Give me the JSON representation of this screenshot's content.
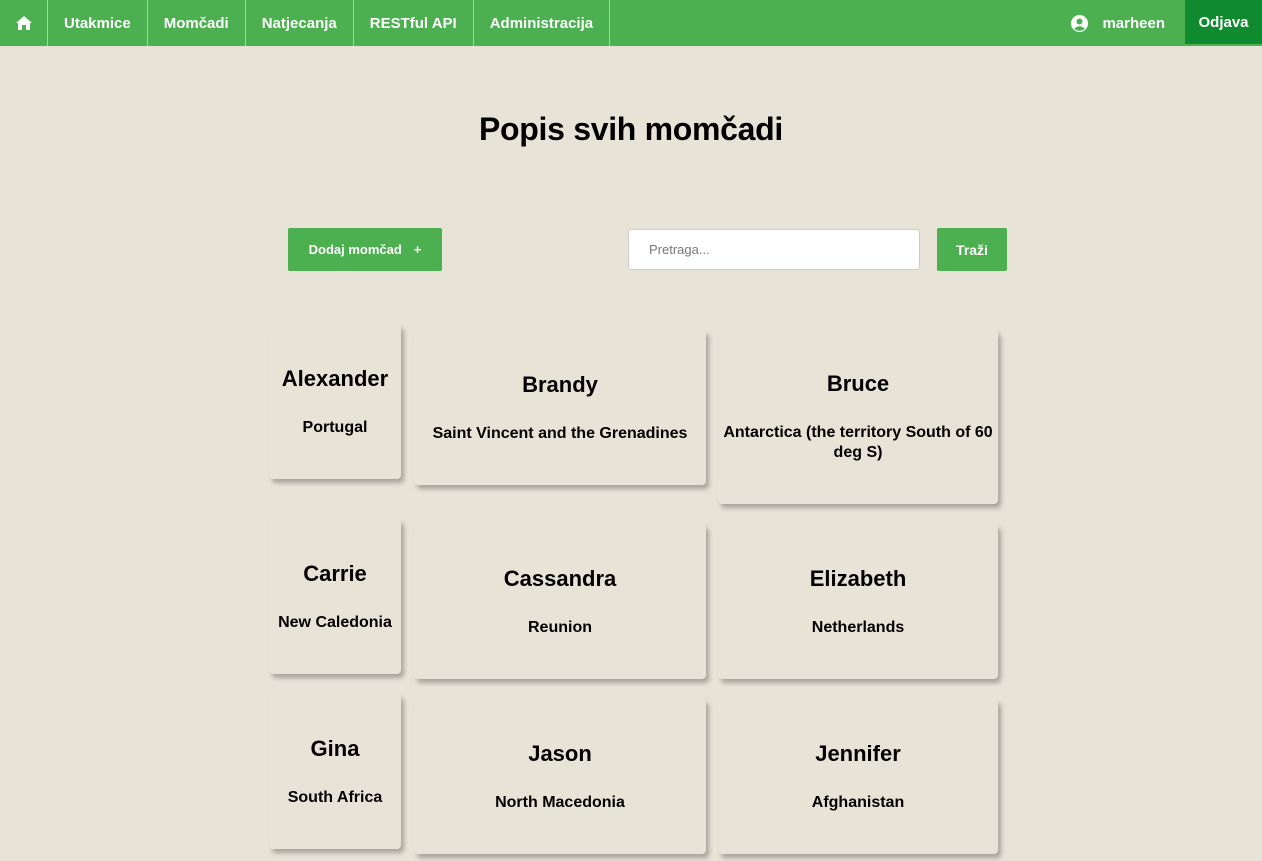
{
  "nav": {
    "home_icon": "home-icon",
    "items": [
      {
        "label": "Utakmice"
      },
      {
        "label": "Momčadi"
      },
      {
        "label": "Natjecanja"
      },
      {
        "label": "RESTful API"
      },
      {
        "label": "Administracija"
      }
    ],
    "user_icon": "user-circle-icon",
    "username": "marheen",
    "logout_label": "Odjava",
    "colors": {
      "bar": "#4caf50",
      "logout": "#108a2e"
    }
  },
  "page": {
    "title": "Popis svih momčadi",
    "background": "#e8e3d7"
  },
  "toolbar": {
    "add_label": "Dodaj momčad",
    "add_icon_glyph": "+",
    "search_placeholder": "Pretraga...",
    "search_value": "",
    "search_button_label": "Traži"
  },
  "teams": [
    {
      "name": "Alexander",
      "country": "Portugal"
    },
    {
      "name": "Brandy",
      "country": "Saint Vincent and the Grenadines"
    },
    {
      "name": "Bruce",
      "country": "Antarctica (the territory South of 60 deg S)"
    },
    {
      "name": "Carrie",
      "country": "New Caledonia"
    },
    {
      "name": "Cassandra",
      "country": "Reunion"
    },
    {
      "name": "Elizabeth",
      "country": "Netherlands"
    },
    {
      "name": "Gina",
      "country": "South Africa"
    },
    {
      "name": "Jason",
      "country": "North Macedonia"
    },
    {
      "name": "Jennifer",
      "country": "Afghanistan"
    }
  ]
}
